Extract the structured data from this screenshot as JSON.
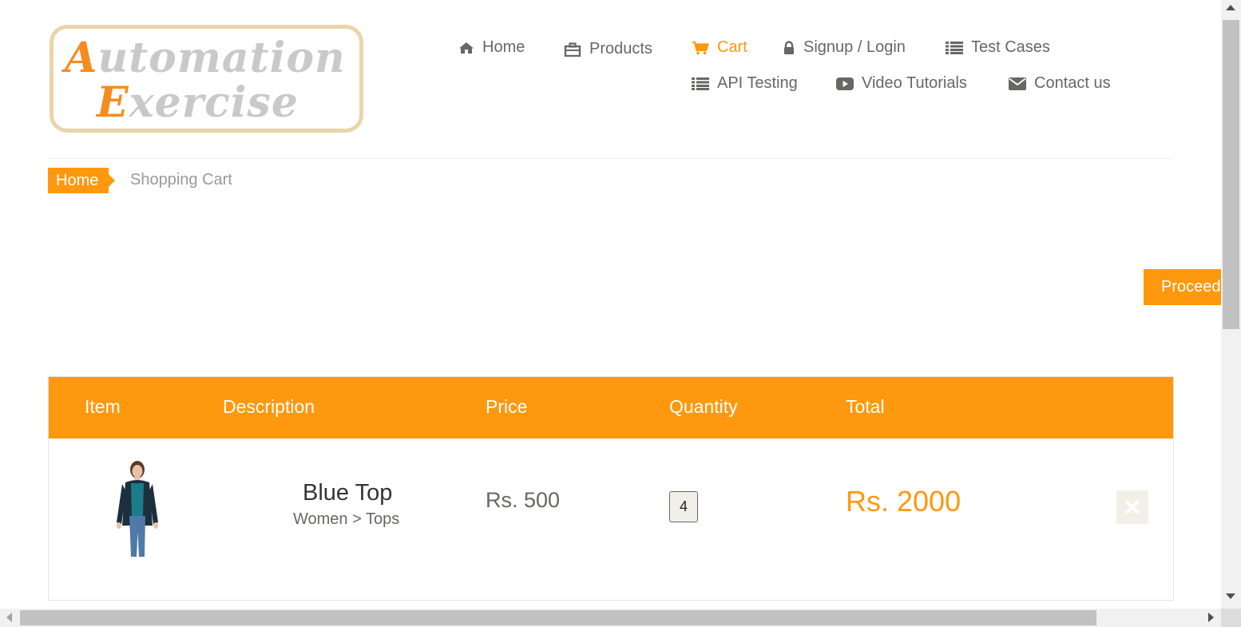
{
  "logo": {
    "line1_cap": "A",
    "line1_rest": "utomation",
    "line2_cap": "E",
    "line2_rest": "xercise"
  },
  "nav": {
    "home": {
      "label": "Home",
      "icon": "home-icon"
    },
    "products": {
      "label": "Products",
      "icon": "briefcase-icon"
    },
    "cart": {
      "label": "Cart",
      "icon": "shopping-cart-icon"
    },
    "signup": {
      "label": "Signup / Login",
      "icon": "lock-icon"
    },
    "test_cases": {
      "label": "Test Cases",
      "icon": "list-icon"
    },
    "api_testing": {
      "label": "API Testing",
      "icon": "list-icon"
    },
    "video_tutorials": {
      "label": "Video Tutorials",
      "icon": "youtube-play-icon"
    },
    "contact": {
      "label": "Contact us",
      "icon": "envelope-icon"
    }
  },
  "breadcrumb": {
    "home": "Home",
    "current": "Shopping Cart"
  },
  "proceed_label": "Proceed",
  "table": {
    "headers": {
      "item": "Item",
      "description": "Description",
      "price": "Price",
      "quantity": "Quantity",
      "total": "Total"
    },
    "rows": [
      {
        "name": "Blue Top",
        "category": "Women > Tops",
        "price": "Rs. 500",
        "quantity": "4",
        "total": "Rs. 2000"
      }
    ]
  },
  "colors": {
    "accent": "#fe980f",
    "text": "#696763"
  }
}
